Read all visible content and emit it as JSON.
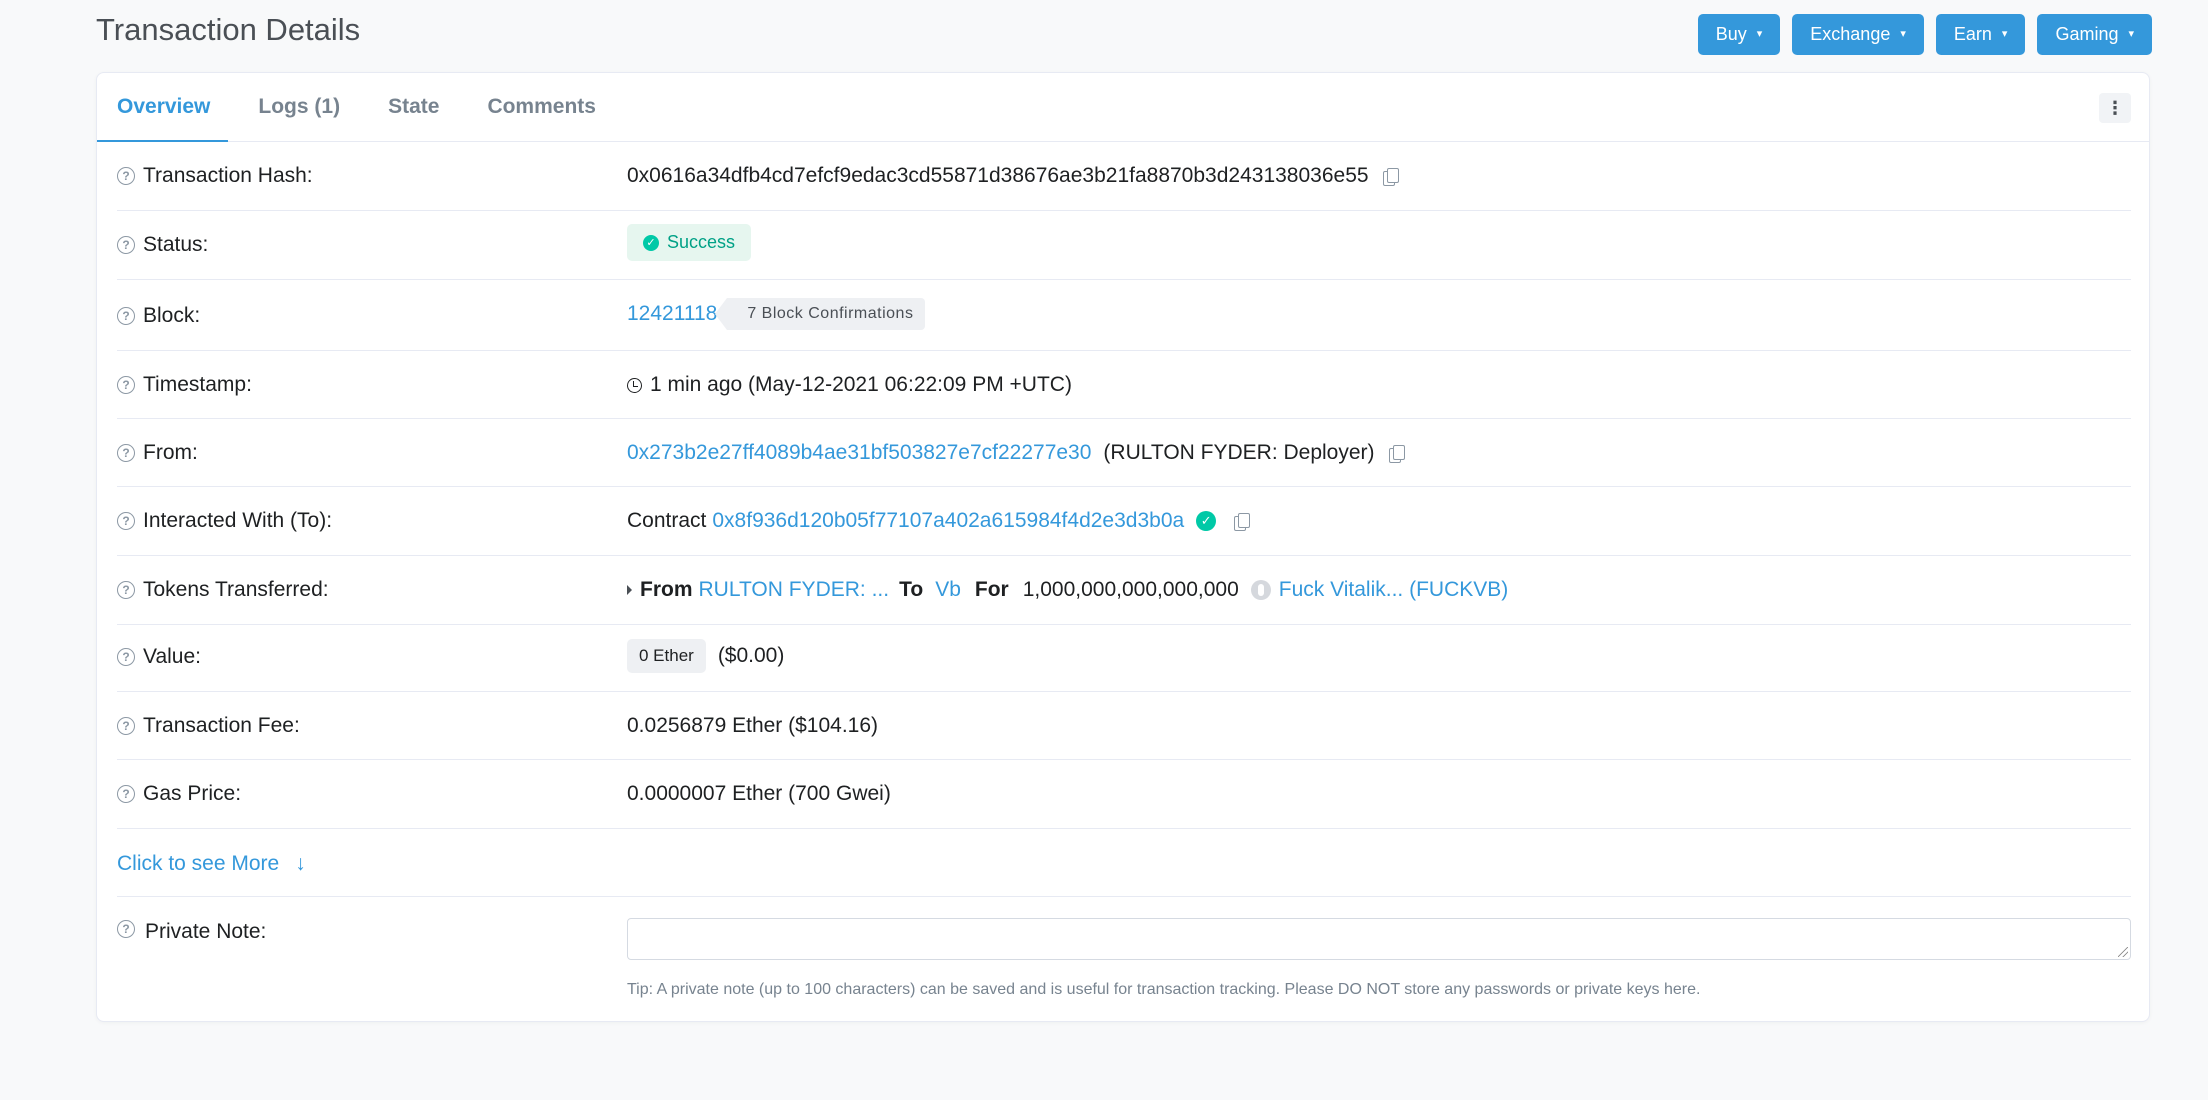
{
  "page": {
    "title": "Transaction Details"
  },
  "top_buttons": [
    {
      "label": "Buy"
    },
    {
      "label": "Exchange"
    },
    {
      "label": "Earn"
    },
    {
      "label": "Gaming"
    }
  ],
  "tabs": [
    {
      "label": "Overview",
      "active": true
    },
    {
      "label": "Logs (1)",
      "active": false
    },
    {
      "label": "State",
      "active": false
    },
    {
      "label": "Comments",
      "active": false
    }
  ],
  "rows": {
    "tx_hash": {
      "label": "Transaction Hash:",
      "value": "0x0616a34dfb4cd7efcf9edac3cd55871d38676ae3b21fa8870b3d243138036e55"
    },
    "status": {
      "label": "Status:",
      "value": "Success"
    },
    "block": {
      "label": "Block:",
      "number": "12421118",
      "confirmations": "7 Block Confirmations"
    },
    "timestamp": {
      "label": "Timestamp:",
      "value": "1 min ago (May-12-2021 06:22:09 PM +UTC)"
    },
    "from": {
      "label": "From:",
      "address": "0x273b2e27ff4089b4ae31bf503827e7cf22277e30",
      "name": "(RULTON FYDER: Deployer)"
    },
    "to": {
      "label": "Interacted With (To):",
      "prefix": "Contract",
      "address": "0x8f936d120b05f77107a402a615984f4d2e3d3b0a"
    },
    "tokens": {
      "label": "Tokens Transferred:",
      "from_word": "From",
      "from_value": "RULTON FYDER: ...",
      "to_word": "To",
      "to_value": "Vb",
      "for_word": "For",
      "amount": "1,000,000,000,000,000",
      "token": "Fuck Vitalik... (FUCKVB)"
    },
    "value": {
      "label": "Value:",
      "ether": "0 Ether",
      "usd": "($0.00)"
    },
    "fee": {
      "label": "Transaction Fee:",
      "value": "0.0256879 Ether ($104.16)"
    },
    "gas": {
      "label": "Gas Price:",
      "value": "0.0000007 Ether (700 Gwei)"
    }
  },
  "see_more": {
    "label": "Click to see More",
    "arrow": "↓"
  },
  "private_note": {
    "label": "Private Note:",
    "value": "",
    "tip": "Tip: A private note (up to 100 characters) can be saved and is useful for transaction tracking. Please DO NOT store any passwords or private keys here."
  },
  "colors": {
    "accent": "#3498db",
    "success": "#00c9a7",
    "text": "#1e2022",
    "muted": "#77838f"
  },
  "icons": {
    "help": "question-circle-icon",
    "copy": "copy-icon",
    "clock": "clock-icon",
    "check": "check-circle-icon",
    "caret": "caret-down-icon"
  }
}
